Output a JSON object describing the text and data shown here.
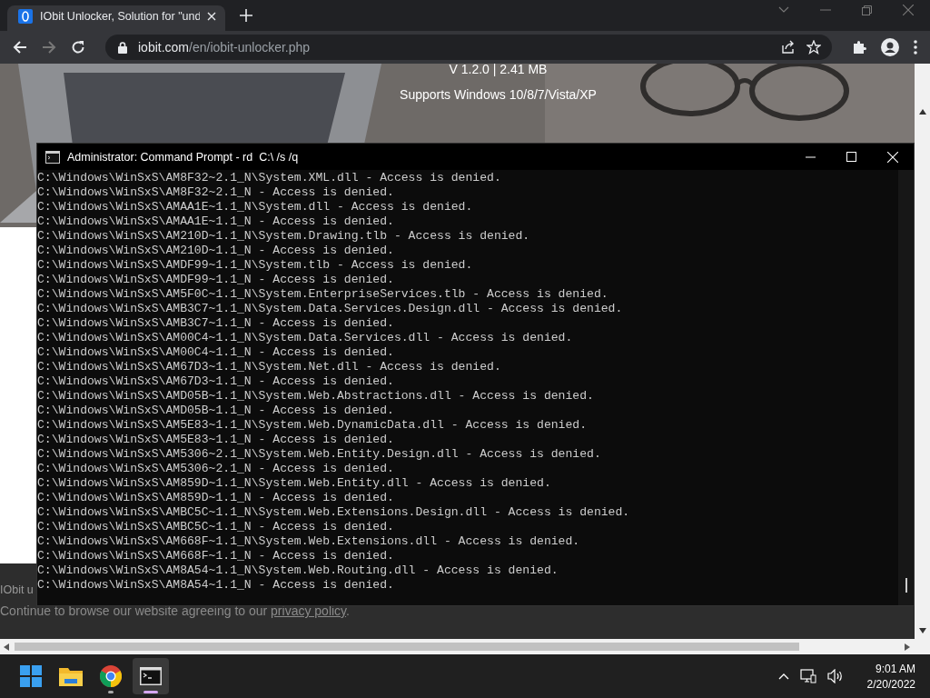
{
  "browser": {
    "tab": {
      "title": "IObit Unlocker, Solution for \"und",
      "selected": true
    },
    "address": {
      "domain": "iobit.com",
      "path": "/en/iobit-unlocker.php"
    }
  },
  "page": {
    "version": "V 1.2.0 | 2.41 MB",
    "supports": "Supports Windows 10/8/7/Vista/XP",
    "cookie": {
      "title": "IObit u",
      "text": "Continue to browse our website agreeing to our ",
      "link": "privacy policy",
      "end": "."
    }
  },
  "console": {
    "title": "Administrator: Command Prompt - rd  C:\\ /s /q",
    "lines": [
      "C:\\Windows\\WinSxS\\AM8F32~2.1_N\\System.XML.dll - Access is denied.",
      "C:\\Windows\\WinSxS\\AM8F32~2.1_N - Access is denied.",
      "C:\\Windows\\WinSxS\\AMAA1E~1.1_N\\System.dll - Access is denied.",
      "C:\\Windows\\WinSxS\\AMAA1E~1.1_N - Access is denied.",
      "C:\\Windows\\WinSxS\\AM210D~1.1_N\\System.Drawing.tlb - Access is denied.",
      "C:\\Windows\\WinSxS\\AM210D~1.1_N - Access is denied.",
      "C:\\Windows\\WinSxS\\AMDF99~1.1_N\\System.tlb - Access is denied.",
      "C:\\Windows\\WinSxS\\AMDF99~1.1_N - Access is denied.",
      "C:\\Windows\\WinSxS\\AM5F0C~1.1_N\\System.EnterpriseServices.tlb - Access is denied.",
      "C:\\Windows\\WinSxS\\AMB3C7~1.1_N\\System.Data.Services.Design.dll - Access is denied.",
      "C:\\Windows\\WinSxS\\AMB3C7~1.1_N - Access is denied.",
      "C:\\Windows\\WinSxS\\AM00C4~1.1_N\\System.Data.Services.dll - Access is denied.",
      "C:\\Windows\\WinSxS\\AM00C4~1.1_N - Access is denied.",
      "C:\\Windows\\WinSxS\\AM67D3~1.1_N\\System.Net.dll - Access is denied.",
      "C:\\Windows\\WinSxS\\AM67D3~1.1_N - Access is denied.",
      "C:\\Windows\\WinSxS\\AMD05B~1.1_N\\System.Web.Abstractions.dll - Access is denied.",
      "C:\\Windows\\WinSxS\\AMD05B~1.1_N - Access is denied.",
      "C:\\Windows\\WinSxS\\AM5E83~1.1_N\\System.Web.DynamicData.dll - Access is denied.",
      "C:\\Windows\\WinSxS\\AM5E83~1.1_N - Access is denied.",
      "C:\\Windows\\WinSxS\\AM5306~2.1_N\\System.Web.Entity.Design.dll - Access is denied.",
      "C:\\Windows\\WinSxS\\AM5306~2.1_N - Access is denied.",
      "C:\\Windows\\WinSxS\\AM859D~1.1_N\\System.Web.Entity.dll - Access is denied.",
      "C:\\Windows\\WinSxS\\AM859D~1.1_N - Access is denied.",
      "C:\\Windows\\WinSxS\\AMBC5C~1.1_N\\System.Web.Extensions.Design.dll - Access is denied.",
      "C:\\Windows\\WinSxS\\AMBC5C~1.1_N - Access is denied.",
      "C:\\Windows\\WinSxS\\AM668F~1.1_N\\System.Web.Extensions.dll - Access is denied.",
      "C:\\Windows\\WinSxS\\AM668F~1.1_N - Access is denied.",
      "C:\\Windows\\WinSxS\\AM8A54~1.1_N\\System.Web.Routing.dll - Access is denied.",
      "C:\\Windows\\WinSxS\\AM8A54~1.1_N - Access is denied."
    ]
  },
  "taskbar": {
    "apps": [
      {
        "kind": "start",
        "running": false,
        "selected": false
      },
      {
        "kind": "explorer",
        "running": false,
        "selected": false
      },
      {
        "kind": "chrome",
        "running": true,
        "selected": false
      },
      {
        "kind": "terminal",
        "running": true,
        "selected": true
      }
    ],
    "time": "9:01 AM",
    "date": "2/20/2022"
  }
}
